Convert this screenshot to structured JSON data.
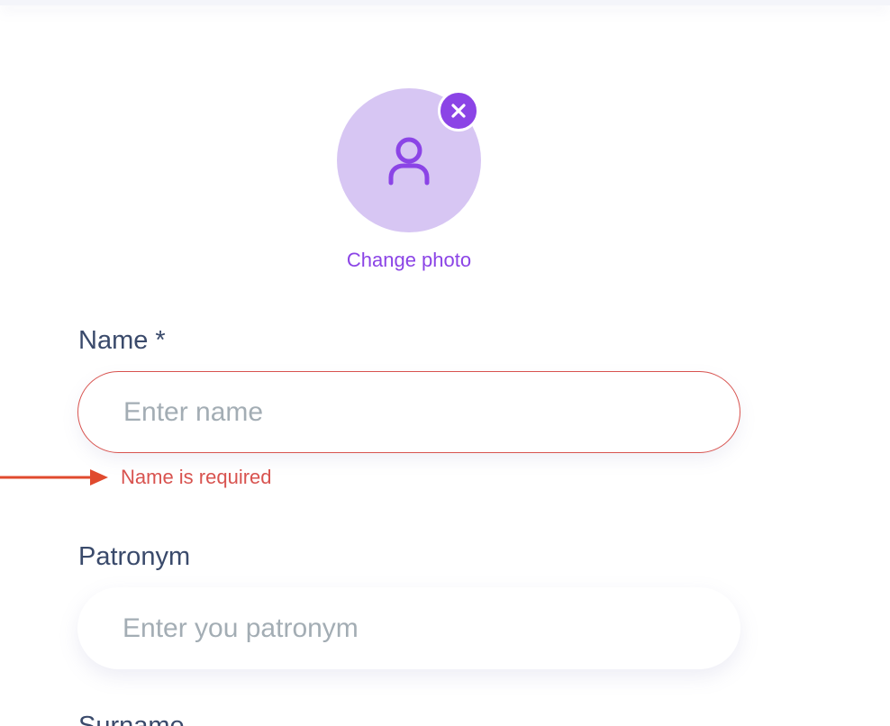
{
  "photo": {
    "change_label": "Change photo",
    "avatar_icon": "user-icon",
    "remove_icon": "close-icon"
  },
  "form": {
    "name": {
      "label": "Name *",
      "placeholder": "Enter name",
      "value": "",
      "error": "Name is required"
    },
    "patronym": {
      "label": "Patronym",
      "placeholder": "Enter you patronym",
      "value": ""
    },
    "surname": {
      "label": "Surname"
    }
  },
  "colors": {
    "accent": "#8b44e6",
    "avatar_bg": "#d7c6f3",
    "error": "#d8534f",
    "label": "#3a4a6b",
    "placeholder": "#a3adb4",
    "annotation_arrow": "#e04a2e"
  }
}
